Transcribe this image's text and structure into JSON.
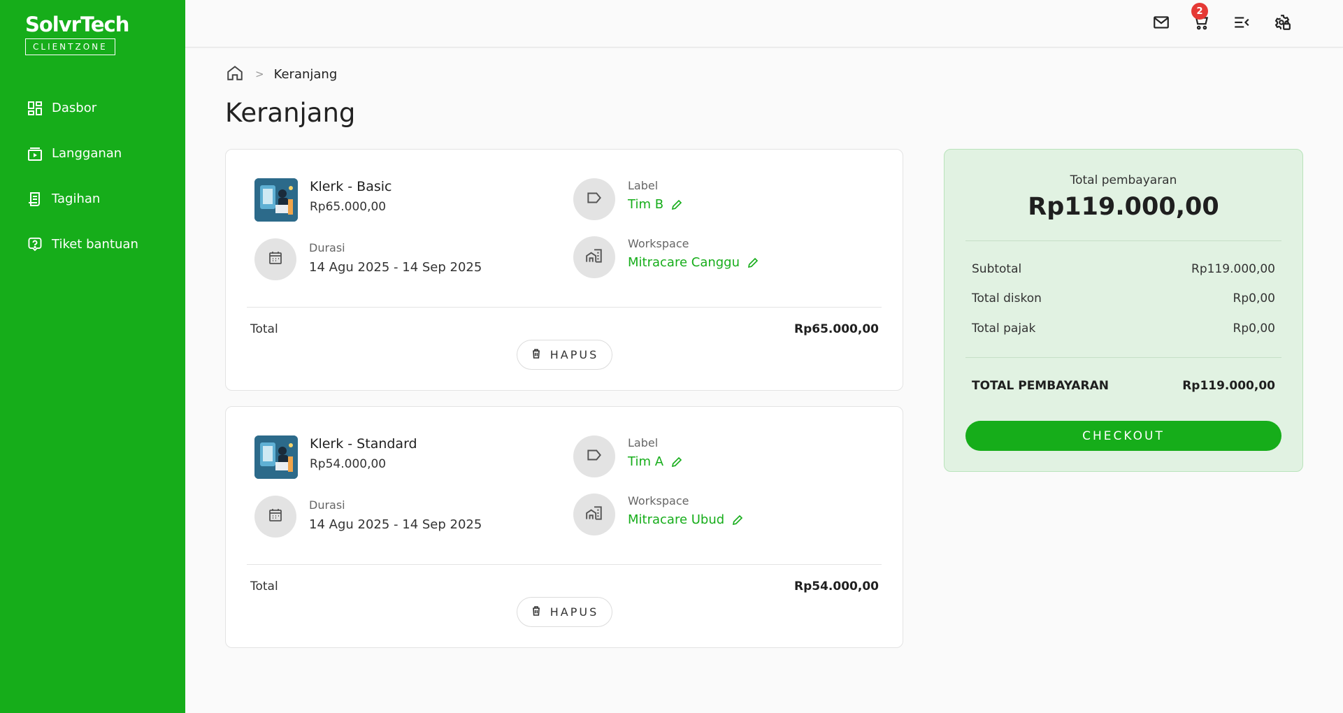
{
  "brand": {
    "name": "SolvrTech",
    "sub": "CLIENTZONE"
  },
  "sidebar": {
    "items": [
      {
        "label": "Dasbor",
        "icon": "dashboard-icon"
      },
      {
        "label": "Langganan",
        "icon": "subscription-icon"
      },
      {
        "label": "Tagihan",
        "icon": "invoice-icon"
      },
      {
        "label": "Tiket bantuan",
        "icon": "help-icon"
      }
    ]
  },
  "topbar": {
    "cart_count": "2",
    "icons": [
      "mail-icon",
      "cart-icon",
      "menu-collapse-icon",
      "settings-icon"
    ]
  },
  "breadcrumb": {
    "separator": ">",
    "current": "Keranjang"
  },
  "page": {
    "title": "Keranjang"
  },
  "cart": {
    "items": [
      {
        "name": "Klerk - Basic",
        "price": "Rp65.000,00",
        "duration_label": "Durasi",
        "duration": "14 Agu 2025 - 14 Sep 2025",
        "label_caption": "Label",
        "label": "Tim B",
        "workspace_caption": "Workspace",
        "workspace": "Mitracare Canggu",
        "total_label": "Total",
        "total": "Rp65.000,00",
        "delete_label": "HAPUS"
      },
      {
        "name": "Klerk - Standard",
        "price": "Rp54.000,00",
        "duration_label": "Durasi",
        "duration": "14 Agu 2025 - 14 Sep 2025",
        "label_caption": "Label",
        "label": "Tim A",
        "workspace_caption": "Workspace",
        "workspace": "Mitracare Ubud",
        "total_label": "Total",
        "total": "Rp54.000,00",
        "delete_label": "HAPUS"
      }
    ]
  },
  "summary": {
    "caption": "Total pembayaran",
    "amount": "Rp119.000,00",
    "subtotal_label": "Subtotal",
    "subtotal": "Rp119.000,00",
    "discount_label": "Total diskon",
    "discount": "Rp0,00",
    "tax_label": "Total pajak",
    "tax": "Rp0,00",
    "grand_label": "TOTAL PEMBAYARAN",
    "grand": "Rp119.000,00",
    "checkout_label": "CHECKOUT"
  },
  "colors": {
    "brand_green": "#16ad1a",
    "summary_bg": "#e1f2e2",
    "badge_red": "#e53935"
  }
}
